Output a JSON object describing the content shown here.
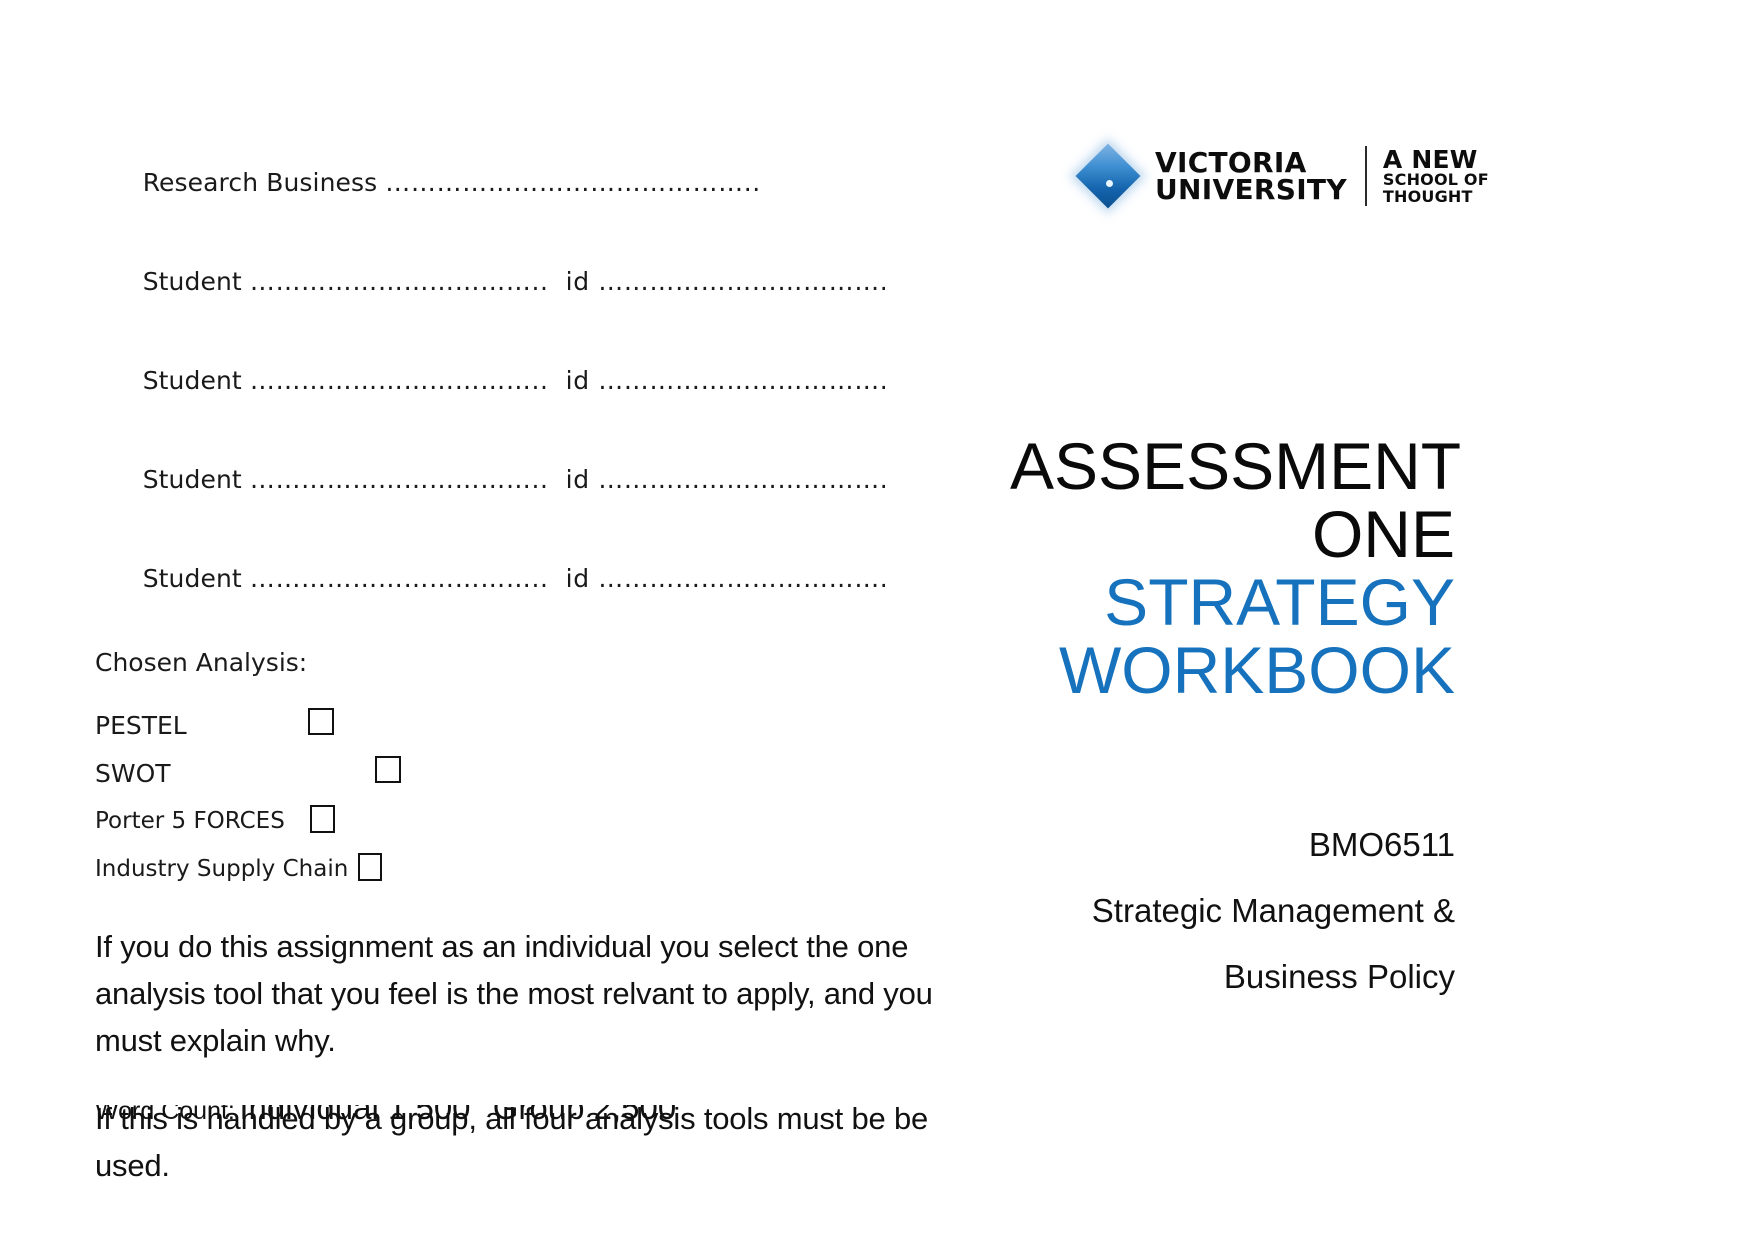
{
  "form": {
    "lines": [
      {
        "label": "Research Business ",
        "dots": "…………………………………….."
      },
      {
        "label": "Student ",
        "dots": "……………………………..  id ……………………………."
      },
      {
        "label": "Student ",
        "dots": "……………………………..  id ……………………………."
      },
      {
        "label": "Student ",
        "dots": "……………………………..  id ……………………………."
      },
      {
        "label": "Student ",
        "dots": "……………………………..  id ……………………………."
      }
    ],
    "chosen_analysis_heading": "Chosen Analysis:",
    "options": [
      {
        "label": "PESTEL",
        "checked": false
      },
      {
        "label": "SWOT",
        "checked": false
      },
      {
        "label": "Porter 5 FORCES",
        "checked": false
      },
      {
        "label": "Industry Supply Chain",
        "checked": false
      }
    ],
    "paragraphs": [
      "If you do this assignment as an individual you select the  one analysis tool that you feel is the most relvant to apply, and you must explain why.",
      "If this is handled by a group, all four analysis tools must be be used."
    ],
    "word_count": {
      "label": "Word Count:",
      "individual": "Individual 1,500",
      "group": "Group 2,500"
    }
  },
  "logo": {
    "name_line1": "VICTORIA",
    "name_line2": "UNIVERSITY",
    "tagline_line1": "A NEW",
    "tagline_line2": "SCHOOL OF",
    "tagline_line3": "THOUGHT",
    "diamond_color": "#1464ad"
  },
  "title": {
    "line1": "ASSESSMENT",
    "line2": "ONE",
    "line3": "STRATEGY",
    "line4": "WORKBOOK",
    "accent_color": "#1672bd"
  },
  "course": {
    "code": "BMO6511",
    "name_line1": "Strategic Management &",
    "name_line2": "Business Policy"
  }
}
